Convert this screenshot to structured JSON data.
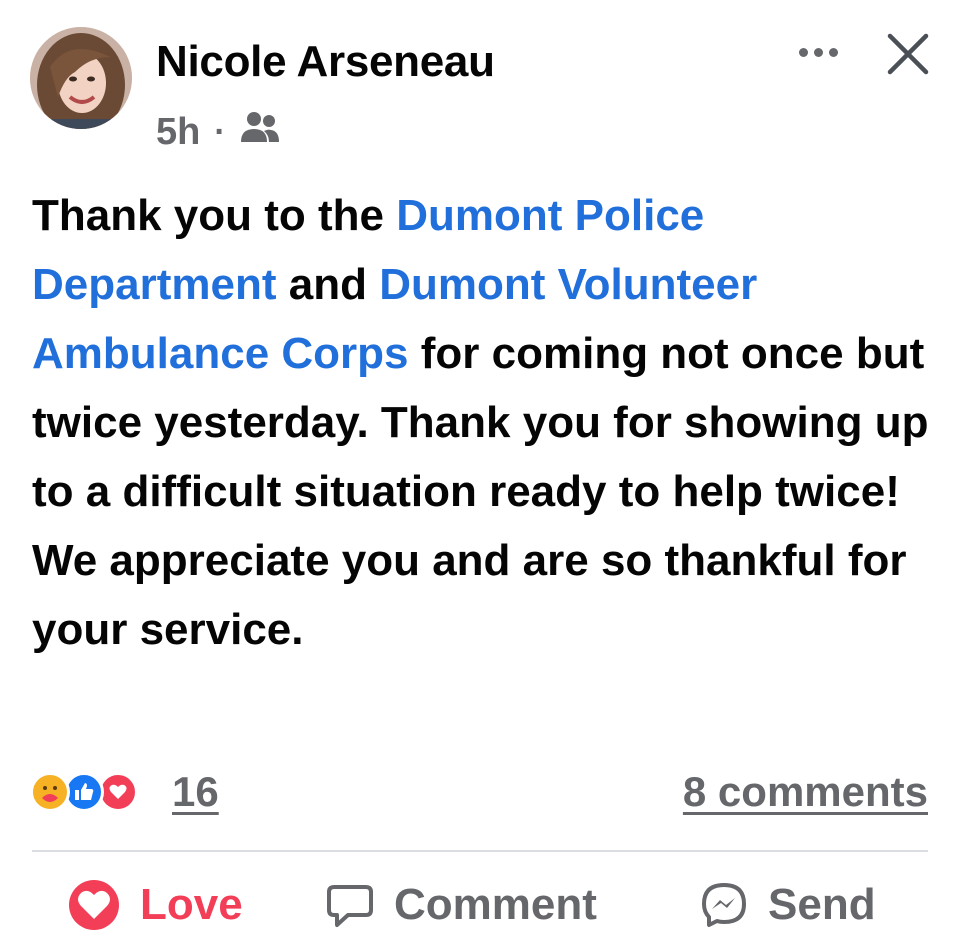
{
  "post": {
    "author": "Nicole Arseneau",
    "time": "5h",
    "separator": "·",
    "audience_icon": "friends-icon",
    "text": {
      "p1": "Thank you to the ",
      "link1": "Dumont Police Department",
      "p2": " and ",
      "link2": "Dumont Volunteer Ambulance Corps",
      "p3": " for coming not once but twice yesterday.   Thank you for showing up to a difficult situation ready to help twice! We appreciate you and are so thankful for your service."
    }
  },
  "stats": {
    "reaction_icons": [
      "care-icon",
      "like-icon",
      "love-icon"
    ],
    "reaction_count": "16",
    "comments": "8 comments"
  },
  "actions": {
    "love": "Love",
    "comment": "Comment",
    "send": "Send"
  },
  "colors": {
    "link": "#216fdb",
    "secondary_text": "#65676b",
    "love": "#f33e58",
    "like": "#1877f2",
    "care": "#f7b125"
  }
}
